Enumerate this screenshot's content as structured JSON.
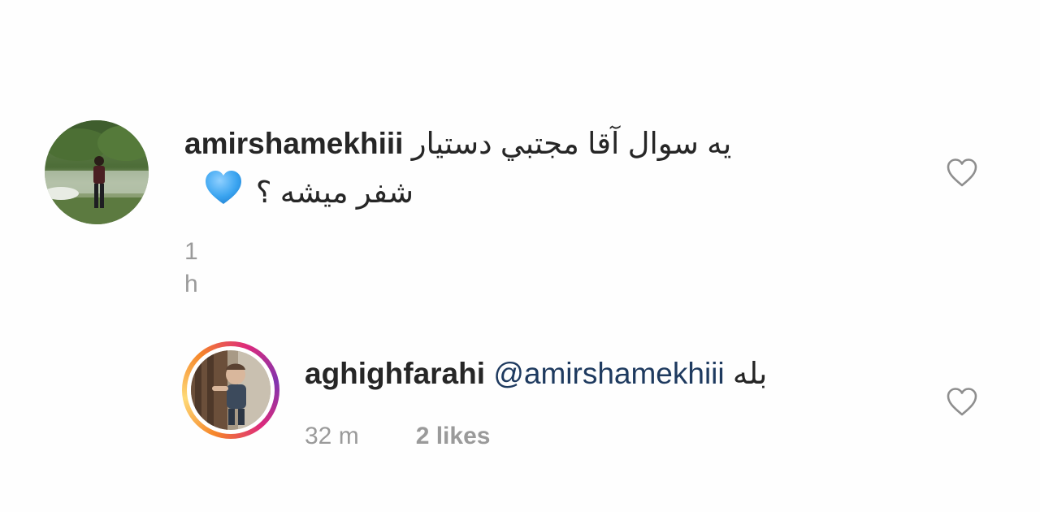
{
  "comments": [
    {
      "username": "amirshamekhiii",
      "text_line1": "یه سوال آقا مجتبي دستيار",
      "text_line2": "شفر میشه ؟",
      "emoji": "blue-heart",
      "time": "1 h",
      "avatar": "profile-photo-outdoors"
    },
    {
      "username": "aghighfarahi",
      "mention": "@amirshamekhiii",
      "text": "بله",
      "time": "32 m",
      "likes": "2 likes",
      "avatar": "profile-photo-child",
      "story_ring": true
    }
  ],
  "icons": {
    "like": "heart-outline-icon"
  },
  "colors": {
    "text": "#262626",
    "meta": "#9a9a9a",
    "mention": "#1e3a5f",
    "emoji_heart": "#3aa4f0"
  }
}
